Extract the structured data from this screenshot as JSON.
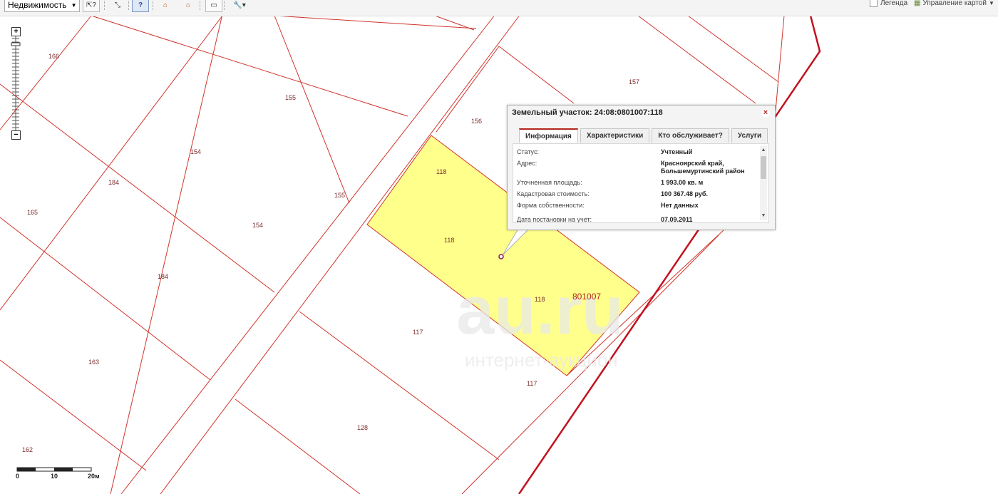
{
  "toolbar": {
    "layer_select": "Недвижимость",
    "legend_label": "Легенда",
    "map_manage_label": "Управление картой"
  },
  "colors": {
    "parcel_border": "#d0342c",
    "selected_fill": "#ffff8c",
    "quarter_border": "#c1121f",
    "label": "#7a2a2a"
  },
  "map": {
    "parcel_labels": [
      "166",
      "155",
      "157",
      "156",
      "154",
      "155",
      "184",
      "165",
      "154",
      "118",
      "118",
      "118",
      "184",
      "117",
      "117",
      "163",
      "128",
      "162"
    ],
    "quarter_label": "801007",
    "watermark_main": "au.ru",
    "watermark_sub": "интернет-аукцион"
  },
  "scale": {
    "labels": [
      "0",
      "10",
      "20м"
    ]
  },
  "popup": {
    "title": "Земельный участок: 24:08:0801007:118",
    "tabs": [
      "Информация",
      "Характеристики",
      "Кто обслуживает?",
      "Услуги"
    ],
    "active_tab": "Информация",
    "rows": [
      {
        "label": "Статус:",
        "value": "Учтенный"
      },
      {
        "label": "Адрес:",
        "value": "Красноярский край, Большемуртинский район"
      },
      {
        "label": "Уточненная площадь:",
        "value": "1 993.00 кв. м"
      },
      {
        "label": "Кадастровая стоимость:",
        "value": "100 367.48 руб."
      },
      {
        "label": "Форма собственности:",
        "value": "Нет данных"
      },
      {
        "label": "Дата постановки на учет:",
        "value": "07.09.2011"
      }
    ]
  }
}
